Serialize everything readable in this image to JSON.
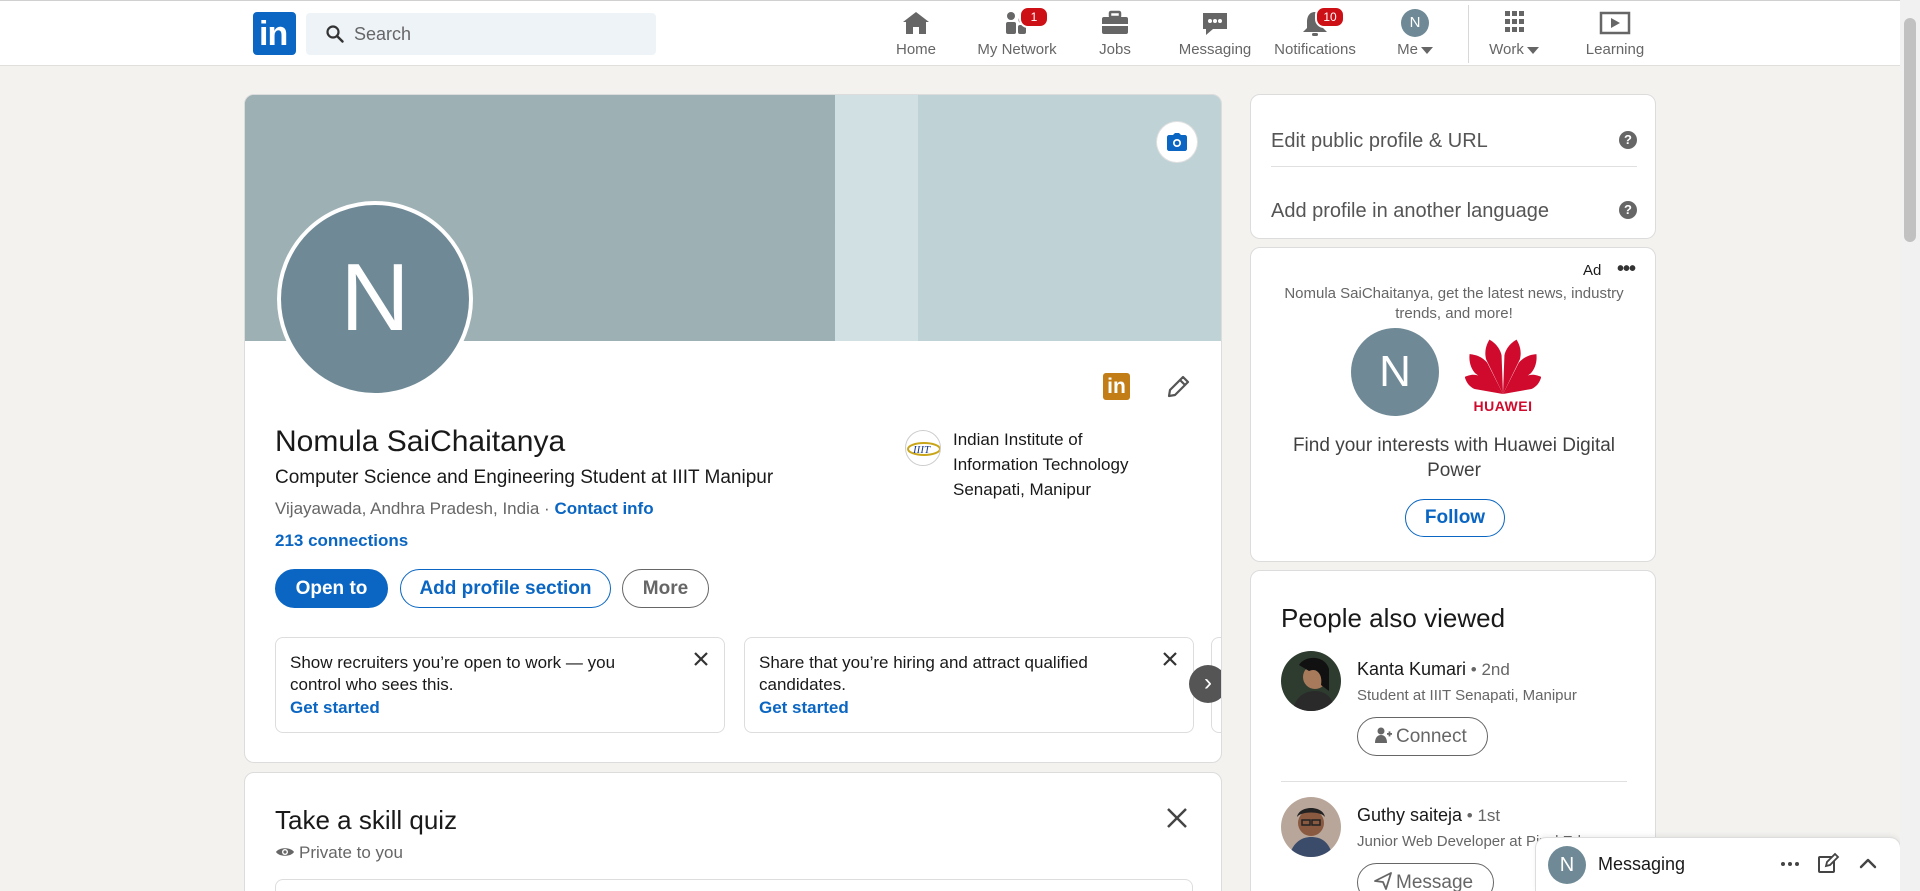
{
  "nav": {
    "search_placeholder": "Search",
    "items": [
      {
        "label": "Home",
        "icon": "home-icon"
      },
      {
        "label": "My Network",
        "icon": "network-icon",
        "badge": "1"
      },
      {
        "label": "Jobs",
        "icon": "briefcase-icon"
      },
      {
        "label": "Messaging",
        "icon": "chat-icon"
      },
      {
        "label": "Notifications",
        "icon": "bell-icon",
        "badge": "10"
      },
      {
        "label": "Me",
        "icon": "avatar"
      },
      {
        "label": "Work",
        "icon": "grid-icon"
      },
      {
        "label": "Learning",
        "icon": "play-icon"
      }
    ],
    "me_initial": "N"
  },
  "profile": {
    "initial": "N",
    "name": "Nomula SaiChaitanya",
    "headline": "Computer Science and Engineering Student at IIIT Manipur",
    "location": "Vijayawada, Andhra Pradesh, India",
    "location_sep": " · ",
    "contact_info": "Contact info",
    "connections": "213 connections",
    "education": "Indian Institute of Information Technology Senapati, Manipur",
    "edu_logo_text": "IIIT",
    "brand_badge": "in",
    "buttons": {
      "open_to": "Open to",
      "add_section": "Add profile section",
      "more": "More"
    },
    "promos": [
      {
        "bold": "Show recruiters you’re open to work",
        "rest": " — you control who sees this.",
        "cta": "Get started"
      },
      {
        "bold": "Share that you’re hiring",
        "rest": " and attract qualified candidates.",
        "cta": "Get started"
      }
    ],
    "carousel_next": "›"
  },
  "quiz": {
    "title": "Take a skill quiz",
    "subtitle": "Private to you"
  },
  "sidebar": {
    "links": [
      {
        "label": "Edit public profile & URL",
        "help": "?"
      },
      {
        "label": "Add profile in another language",
        "help": "?"
      }
    ]
  },
  "ad": {
    "label": "Ad",
    "dots": "•••",
    "message": "Nomula SaiChaitanya,  get the latest news, industry trends, and more!",
    "initial": "N",
    "brand": "HUAWEI",
    "text": "Find your interests with Huawei Digital Power",
    "follow": "Follow"
  },
  "people_also_viewed": {
    "title": "People also viewed",
    "people": [
      {
        "name": "Kanta Kumari",
        "degree": " • 2nd",
        "title": "Student at IIIT Senapati, Manipur",
        "button": "Connect"
      },
      {
        "name": "Guthy saiteja",
        "degree": " • 1st",
        "title": "Junior Web Developer at Pixel Ed",
        "button": "Message"
      }
    ]
  },
  "messaging": {
    "initial": "N",
    "label": "Messaging"
  },
  "colors": {
    "brand": "#0a66c2",
    "badge": "#cc1016",
    "background": "#f3f2ef"
  }
}
